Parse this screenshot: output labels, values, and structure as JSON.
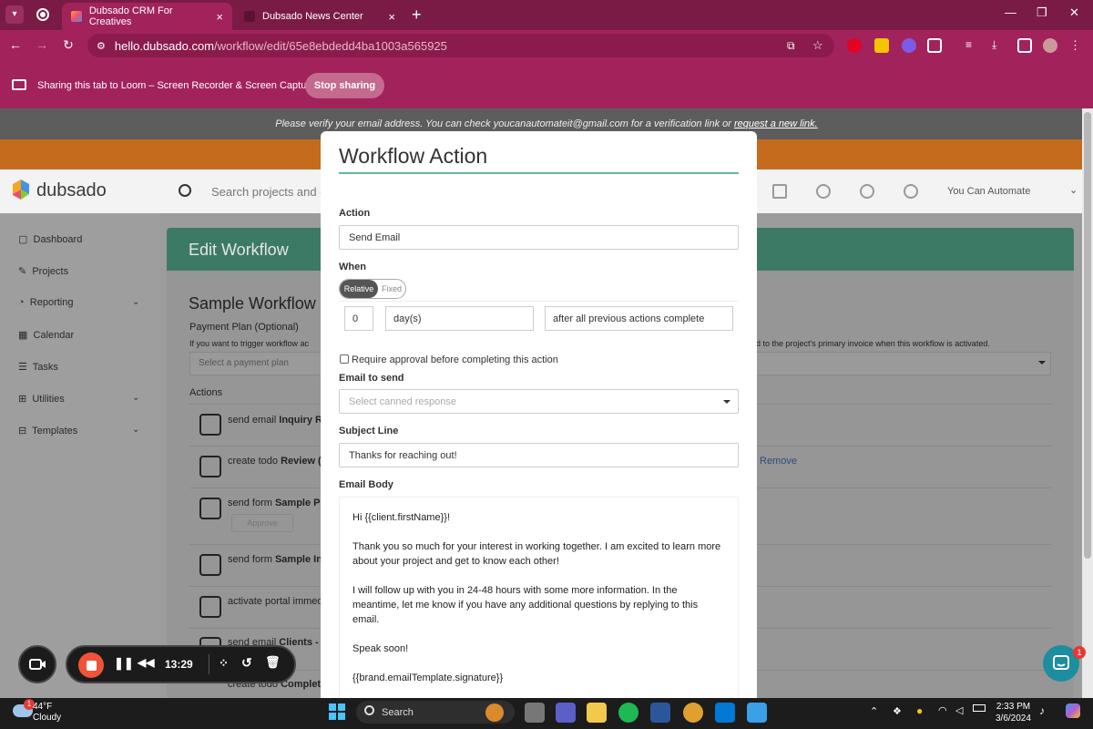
{
  "browser": {
    "tabs": [
      {
        "title": "Dubsado CRM For Creatives"
      },
      {
        "title": "Dubsado News Center"
      }
    ],
    "url_host": "hello.dubsado.com",
    "url_path": "/workflow/edit/65e8ebdedd4ba1003a565925",
    "share_text": "Sharing this tab to Loom – Screen Recorder & Screen Capture",
    "stop_sharing": "Stop sharing"
  },
  "banner": {
    "text": "Please verify your email address. You can check youcanautomateit@gmail.com for a verification link or ",
    "link": "request a new link."
  },
  "app": {
    "logo": "dubsado",
    "search_placeholder": "Search projects and c",
    "user": "You Can Automate",
    "sidebar": [
      {
        "label": "Dashboard"
      },
      {
        "label": "Projects"
      },
      {
        "label": "Reporting"
      },
      {
        "label": "Calendar"
      },
      {
        "label": "Tasks"
      },
      {
        "label": "Utilities"
      },
      {
        "label": "Templates"
      }
    ],
    "edit_title": "Edit Workflow",
    "workflow_name": "Sample Workflow",
    "payment_plan_label": "Payment Plan (Optional)",
    "payment_hint": "If you want to trigger workflow ac",
    "payment_hint_right": "d to the project's primary invoice when this workflow is activated.",
    "payment_placeholder": "Select a payment plan",
    "actions_label": "Actions",
    "actions": [
      {
        "prefix": "send email ",
        "bold": "Inquiry Re"
      },
      {
        "prefix": "create todo ",
        "bold": "Review ("
      },
      {
        "prefix": "send form ",
        "bold": "Sample Pa"
      },
      {
        "prefix": "send form ",
        "bold": "Sample In"
      },
      {
        "prefix": "activate portal immed",
        "bold": ""
      },
      {
        "prefix": "send email ",
        "bold": "Clients - I"
      },
      {
        "prefix": "create todo ",
        "bold": "Complet"
      }
    ],
    "approve_label": "Approve",
    "remove_label": "Remove"
  },
  "modal": {
    "title": "Workflow Action",
    "action_label": "Action",
    "action_value": "Send Email",
    "when_label": "When",
    "when_relative": "Relative",
    "when_fixed": "Fixed",
    "amount": "0",
    "unit": "day(s)",
    "trigger": "after all previous actions complete",
    "require_approval": "Require approval before completing this action",
    "email_label": "Email to send",
    "email_placeholder": "Select canned response",
    "subject_label": "Subject Line",
    "subject_value": "Thanks for reaching out!",
    "body_label": "Email Body",
    "body": [
      "Hi {{client.firstName}}!",
      "Thank you so much for your interest in working together. I am excited to learn more about your project and get to know each other!",
      "I will follow up with you in 24-48 hours with some more information. In the meantime, let me know if you have any additional questions by replying to this email.",
      "Speak soon!",
      "{{brand.emailTemplate.signature}}"
    ]
  },
  "loom": {
    "time": "13:29"
  },
  "chat": {
    "badge": "1"
  },
  "taskbar": {
    "temp": "44°F",
    "condition": "Cloudy",
    "weather_badge": "1",
    "search": "Search",
    "time": "2:33 PM",
    "date": "3/6/2024"
  },
  "colors": {
    "browser": "#a2225c",
    "accent": "#6bb29f",
    "header_green": "#3d7a66"
  }
}
